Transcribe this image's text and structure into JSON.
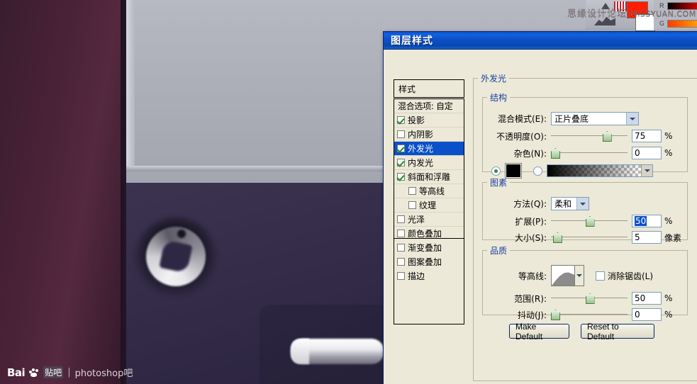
{
  "watermarks": {
    "top_right_text": "思缘设计论坛",
    "top_right_domain": "MISSYUAN.COM",
    "bottom_left_brand": "Bai",
    "bottom_left_tieba": "贴吧",
    "bottom_left_sep": "|",
    "bottom_left_forum": "photoshop吧"
  },
  "color_panel": {
    "r_label": "R",
    "g_label": "G"
  },
  "dialog": {
    "title": "图层样式",
    "styles_header": "样式",
    "blend_options": "混合选项: 自定",
    "style_items": [
      {
        "label": "投影",
        "checked": true,
        "selected": false,
        "indent": false
      },
      {
        "label": "内阴影",
        "checked": false,
        "selected": false,
        "indent": false
      },
      {
        "label": "外发光",
        "checked": true,
        "selected": true,
        "indent": false
      },
      {
        "label": "内发光",
        "checked": true,
        "selected": false,
        "indent": false
      },
      {
        "label": "斜面和浮雕",
        "checked": true,
        "selected": false,
        "indent": false
      },
      {
        "label": "等高线",
        "checked": false,
        "selected": false,
        "indent": true
      },
      {
        "label": "纹理",
        "checked": false,
        "selected": false,
        "indent": true
      },
      {
        "label": "光泽",
        "checked": false,
        "selected": false,
        "indent": false
      },
      {
        "label": "颜色叠加",
        "checked": false,
        "selected": false,
        "indent": false
      },
      {
        "label": "渐变叠加",
        "checked": false,
        "selected": false,
        "indent": false
      },
      {
        "label": "图案叠加",
        "checked": false,
        "selected": false,
        "indent": false
      },
      {
        "label": "描边",
        "checked": false,
        "selected": false,
        "indent": false
      }
    ],
    "pane_title": "外发光",
    "structure": {
      "legend": "结构",
      "blend_mode_label": "混合模式(E):",
      "blend_mode_value": "正片叠底",
      "opacity_label": "不透明度(O):",
      "opacity_value": "75",
      "opacity_unit": "%",
      "opacity_percent": 75,
      "noise_label": "杂色(N):",
      "noise_value": "0",
      "noise_unit": "%",
      "noise_percent": 0,
      "color_radio_selected": true,
      "color_swatch_hex": "#000000",
      "gradient_radio_selected": false
    },
    "elements": {
      "legend": "图素",
      "technique_label": "方法(Q):",
      "technique_value": "柔和",
      "spread_label": "扩展(P):",
      "spread_value": "50",
      "spread_unit": "%",
      "spread_percent": 50,
      "spread_value_selected": true,
      "size_label": "大小(S):",
      "size_value": "5",
      "size_unit": "像素",
      "size_percent": 3
    },
    "quality": {
      "legend": "品质",
      "contour_label": "等高线:",
      "antialias_label": "消除锯齿(L)",
      "antialias_checked": false,
      "range_label": "范围(R):",
      "range_value": "50",
      "range_unit": "%",
      "range_percent": 50,
      "jitter_label": "抖动(J):",
      "jitter_value": "0",
      "jitter_unit": "%",
      "jitter_percent": 0
    },
    "buttons": {
      "make_default": "Make Default",
      "reset_to_default": "Reset to Default"
    },
    "colors": {
      "titlebar_blue": "#0b4fc4",
      "selection_blue": "#0a50c8",
      "legend_blue": "#1a3f9e",
      "dialog_face": "#ece9d8"
    }
  }
}
